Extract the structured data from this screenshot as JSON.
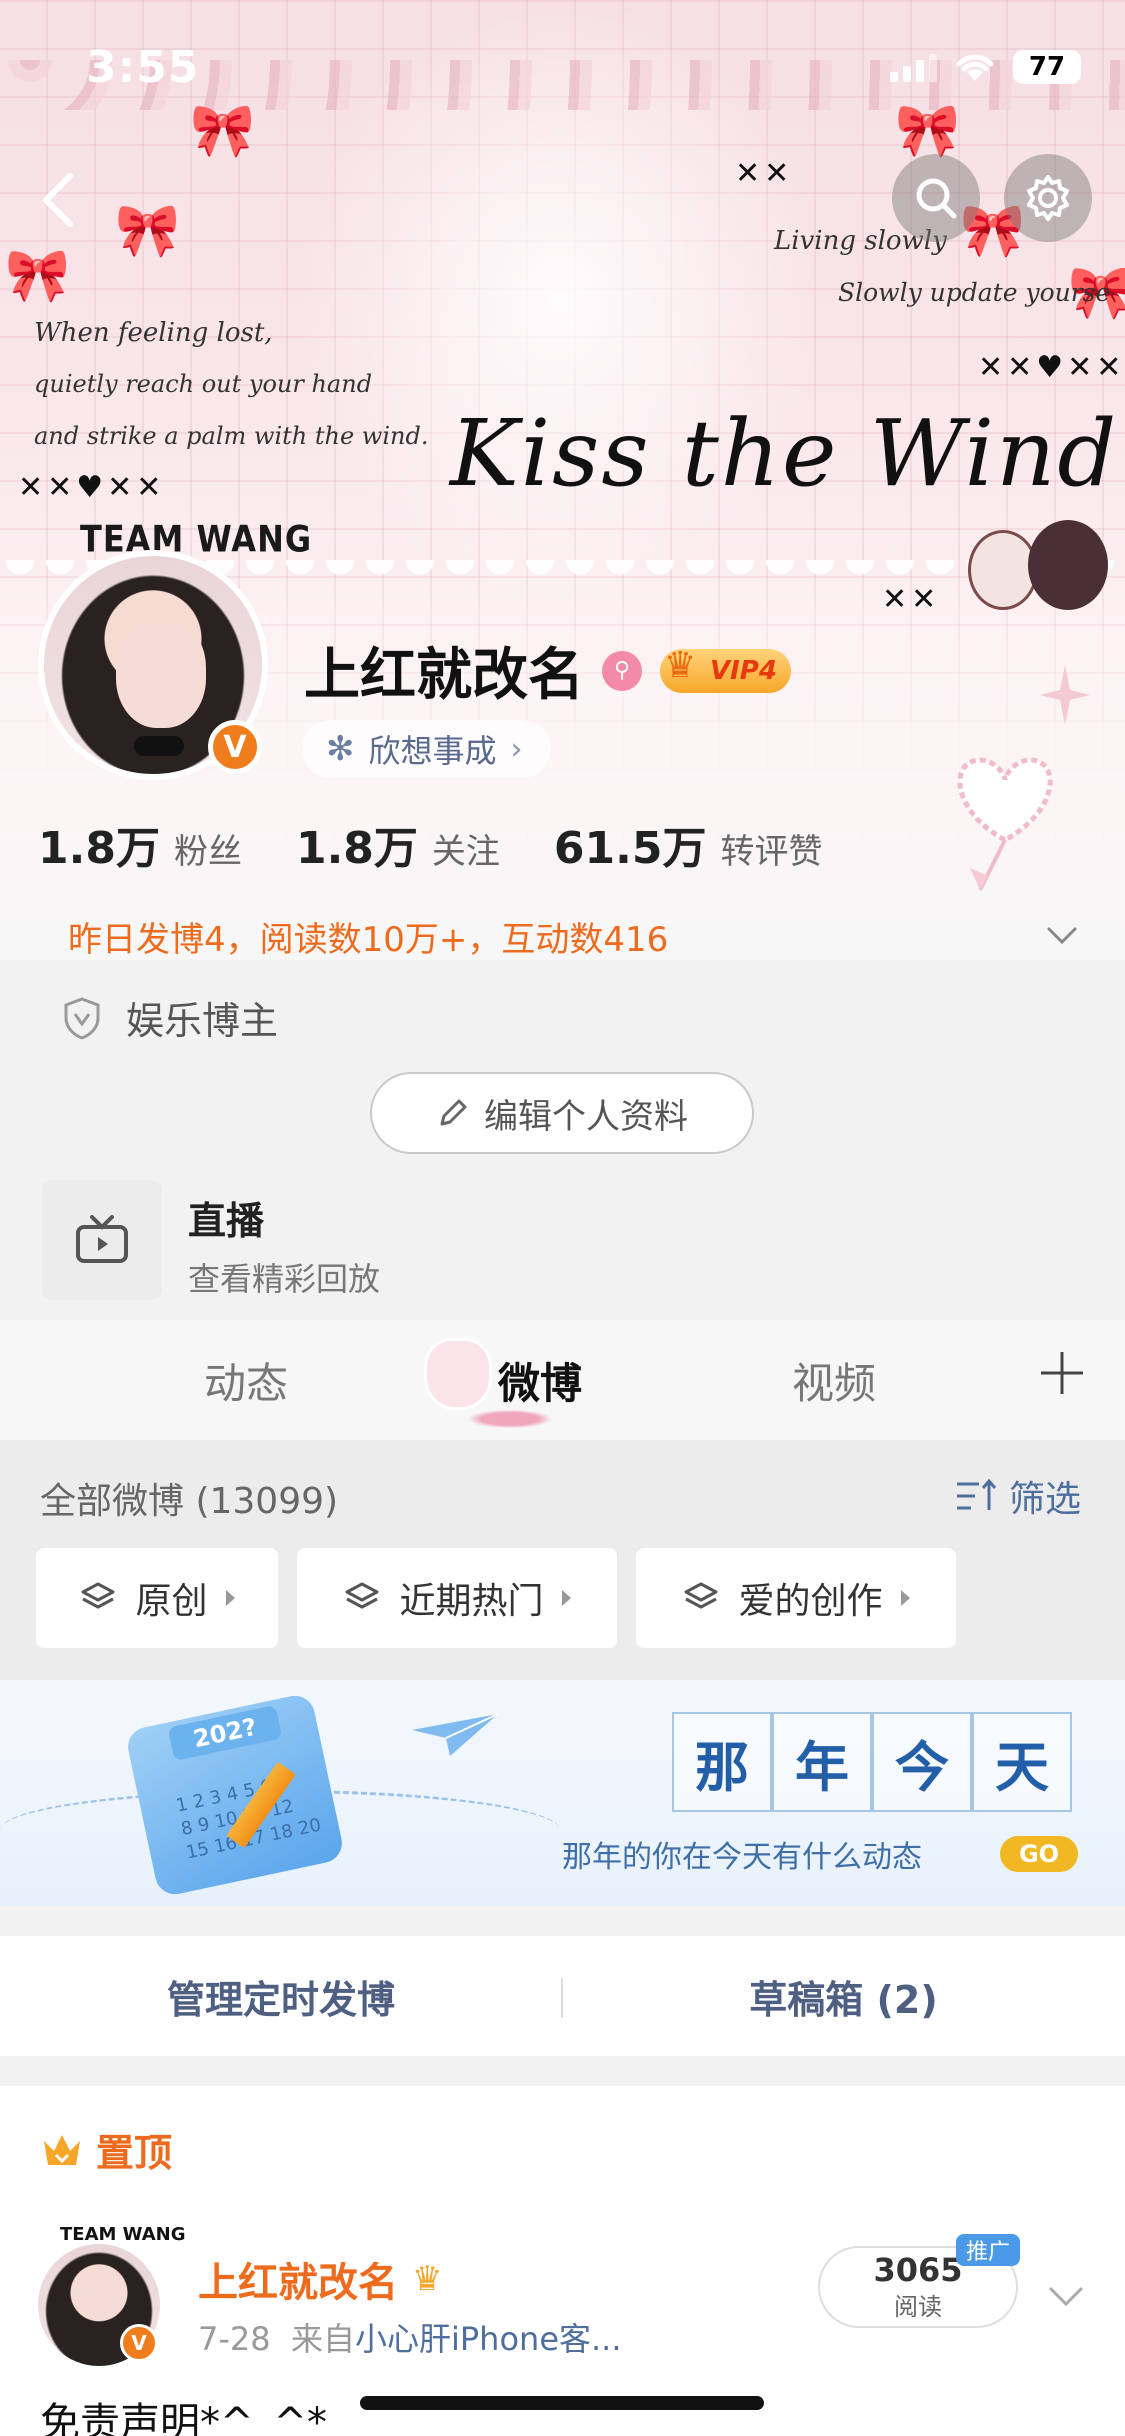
{
  "status_bar": {
    "time": "3:55",
    "battery": "77"
  },
  "banner": {
    "left_script": [
      "When feeling lost,",
      "quietly reach out your hand",
      "and strike a palm with the wind."
    ],
    "right_script": [
      "Living slowly",
      "Slowly update yourse"
    ],
    "title_script": "Kiss the Wind",
    "team_label": "TEAM WANG"
  },
  "profile": {
    "username": "上红就改名",
    "vip_label": "VIP4",
    "wish_label": "欣想事成",
    "stats": [
      {
        "value": "1.8万",
        "label": "粉丝"
      },
      {
        "value": "1.8万",
        "label": "关注"
      },
      {
        "value": "61.5万",
        "label": "转评赞"
      }
    ],
    "activity": "昨日发博4，阅读数10万+，互动数416",
    "tag": "娱乐博主",
    "edit_button": "编辑个人资料"
  },
  "live": {
    "title": "直播",
    "subtitle": "查看精彩回放"
  },
  "tabs": [
    {
      "label": "动态"
    },
    {
      "label": "微博"
    },
    {
      "label": "视频"
    }
  ],
  "feed_header": {
    "all_label": "全部微博 (13099)",
    "filter_label": "筛选"
  },
  "chips": [
    {
      "label": "原创"
    },
    {
      "label": "近期热门"
    },
    {
      "label": "爱的创作"
    }
  ],
  "memory_banner": {
    "calendar_year": "202?",
    "calendar_numbers": "1 2 3 4 5 6\n8 9 10 11 12\n15 16 17 18 20",
    "title_chars": [
      "那",
      "年",
      "今",
      "天"
    ],
    "subtitle": "那年的你在今天有什么动态",
    "go_label": "GO"
  },
  "manage": {
    "schedule_label": "管理定时发博",
    "drafts_label": "草稿箱 (2)"
  },
  "pinned_post": {
    "pin_label": "置顶",
    "team_label": "TEAM WANG",
    "author": "上红就改名",
    "date": "7-28",
    "source_prefix": "来自",
    "source": "小心肝iPhone客...",
    "reads_value": "3065",
    "reads_label": "阅读",
    "promo_label": "推广",
    "text": "免责声明*^_^*"
  },
  "colors": {
    "accent_orange": "#ee6b1e",
    "link_blue": "#4e6e9e",
    "vip_gold": "#f7a629"
  }
}
